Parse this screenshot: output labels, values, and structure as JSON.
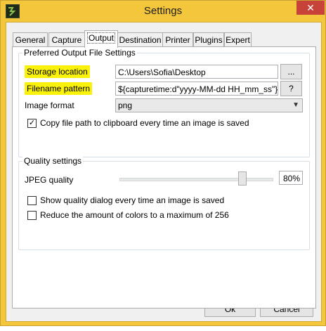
{
  "window": {
    "title": "Settings",
    "close_glyph": "✕",
    "accent": "#f4c63c"
  },
  "tabs": [
    {
      "label": "General",
      "active": false
    },
    {
      "label": "Capture",
      "active": false
    },
    {
      "label": "Output",
      "active": true
    },
    {
      "label": "Destination",
      "active": false
    },
    {
      "label": "Printer",
      "active": false
    },
    {
      "label": "Plugins",
      "active": false
    },
    {
      "label": "Expert",
      "active": false
    }
  ],
  "output_settings": {
    "legend": "Preferred Output File Settings",
    "storage_location": {
      "label": "Storage location",
      "value": "C:\\Users\\Sofia\\Desktop",
      "button": "..."
    },
    "filename_pattern": {
      "label": "Filename pattern",
      "value": "${capturetime:d\"yyyy-MM-dd HH_mm_ss\"}-${title}",
      "button": "?"
    },
    "image_format": {
      "label": "Image format",
      "value": "png"
    },
    "copy_path": {
      "label": "Copy file path to clipboard every time an image is saved",
      "checked": true,
      "mark": "✓"
    }
  },
  "quality": {
    "legend": "Quality settings",
    "jpeg_quality_label": "JPEG quality",
    "jpeg_quality_value": "80%",
    "jpeg_quality_level": 0.8,
    "show_dialog": {
      "label": "Show quality dialog every time an image is saved",
      "checked": false
    },
    "reduce_colors": {
      "label": "Reduce the amount of colors to a maximum of 256",
      "checked": false
    }
  },
  "buttons": {
    "ok": "Ok",
    "cancel": "Cancel"
  }
}
